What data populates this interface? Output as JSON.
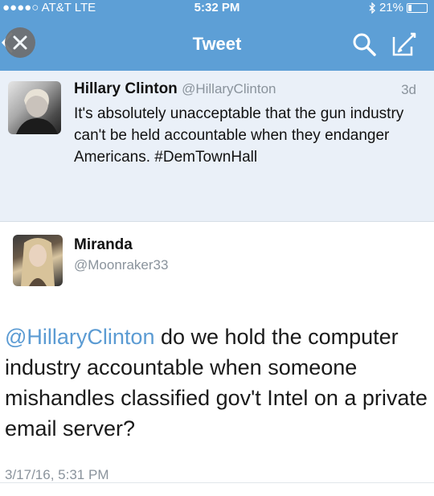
{
  "status_bar": {
    "signal": "●●●●○",
    "carrier": "AT&T",
    "network": "LTE",
    "time": "5:32 PM",
    "bluetooth_icon": "bluetooth-icon",
    "battery_percent": "21%",
    "battery_level": 0.21
  },
  "nav": {
    "title": "Tweet",
    "back_icon": "chevron-left-icon",
    "close_icon": "close-icon",
    "search_icon": "search-icon",
    "compose_icon": "compose-icon"
  },
  "original_tweet": {
    "name": "Hillary Clinton",
    "handle": "@HillaryClinton",
    "time": "3d",
    "text": "It's absolutely unacceptable that the gun industry can't be held accountable when they endanger Americans. #DemTownHall"
  },
  "reply": {
    "name": "Miranda",
    "handle": "@Moonraker33",
    "mention": "@HillaryClinton",
    "text": " do we hold the computer industry accountable when someone mishandles classified gov't Intel on a private email server?",
    "date": "3/17/16, 5:31 PM"
  },
  "colors": {
    "brand_blue": "#5d9fd6",
    "mention_blue": "#5b9bd3",
    "muted_gray": "#8a939c",
    "tweet_bg": "#eaf0f8"
  }
}
